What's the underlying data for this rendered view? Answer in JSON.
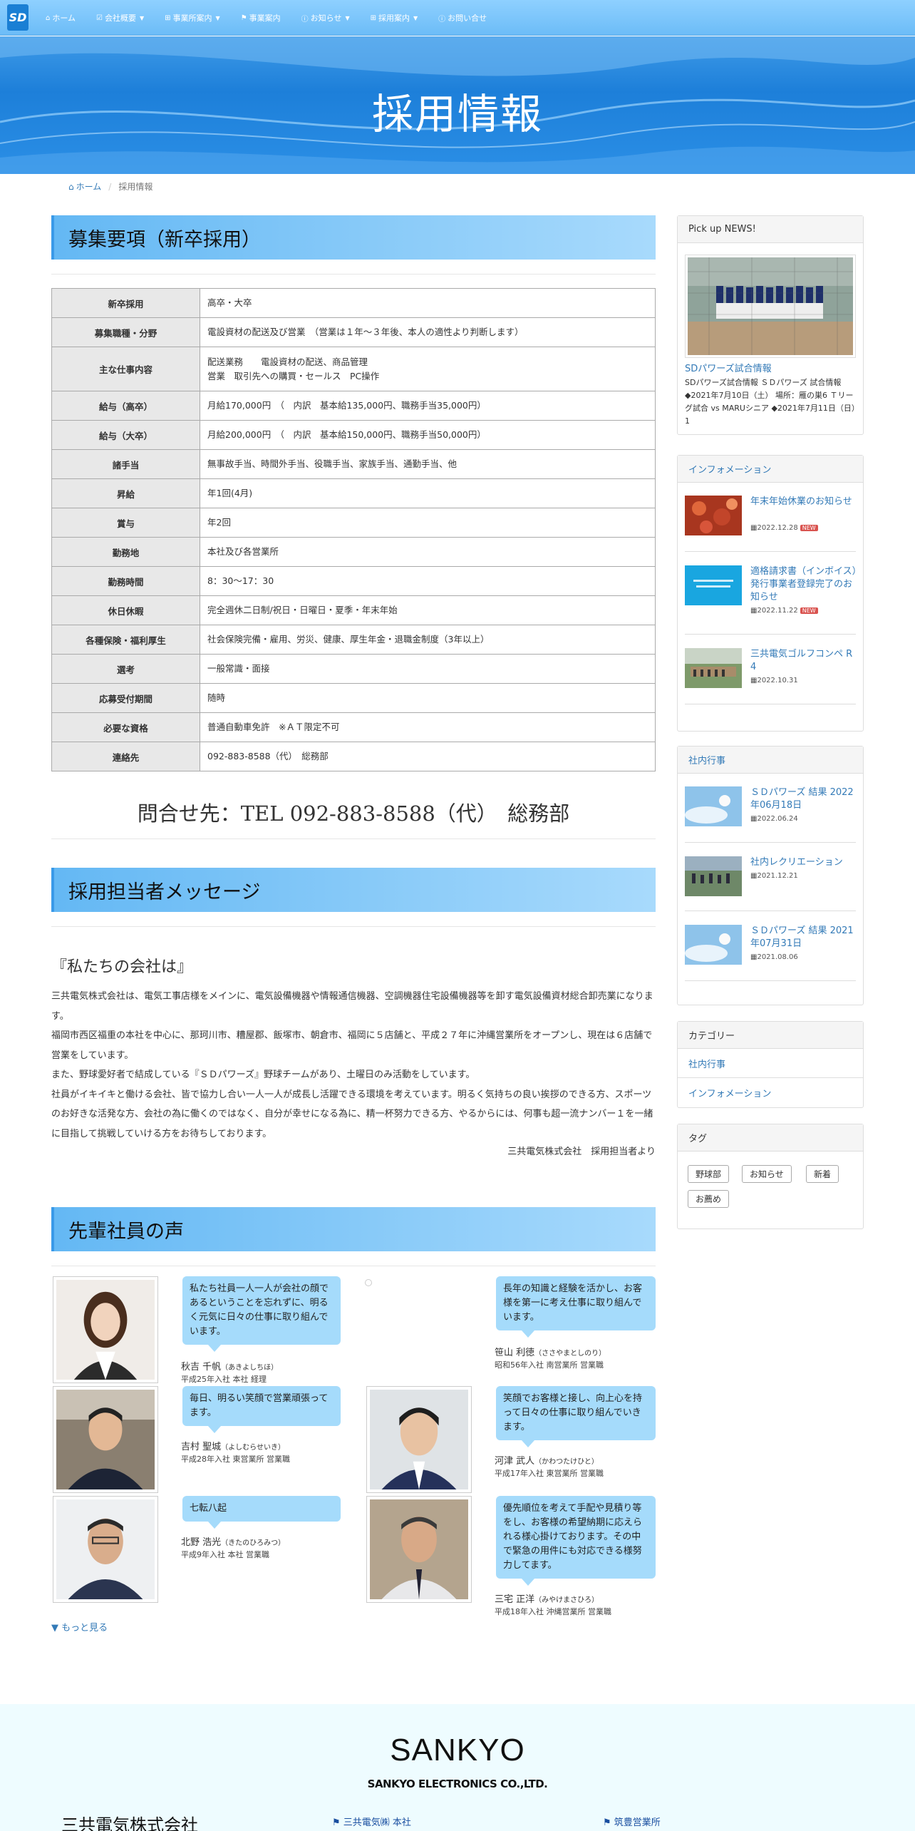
{
  "nav": {
    "logo": "SD",
    "items": [
      {
        "label": "ホーム",
        "icon": "home-icon",
        "caret": false
      },
      {
        "label": "会社概要",
        "icon": "check-icon",
        "caret": true
      },
      {
        "label": "事業所案内",
        "icon": "plus-box-icon",
        "caret": true
      },
      {
        "label": "事業案内",
        "icon": "flag-icon",
        "caret": false
      },
      {
        "label": "お知らせ",
        "icon": "info-icon",
        "caret": true
      },
      {
        "label": "採用案内",
        "icon": "plus-box-icon",
        "caret": true
      },
      {
        "label": "お問い合せ",
        "icon": "info-icon",
        "caret": false
      }
    ]
  },
  "hero": {
    "title": "採用情報"
  },
  "breadcrumb": {
    "home": "ホーム",
    "separator": "/",
    "current": "採用情報"
  },
  "requirements": {
    "heading": "募集要項（新卒採用）",
    "rows": [
      {
        "k": "新卒採用",
        "v": "高卒・大卒"
      },
      {
        "k": "募集職種・分野",
        "v": "電設資材の配送及び営業　（営業は１年～３年後、本人の適性より判断します）"
      },
      {
        "k": "主な仕事内容",
        "v": "配送業務　　電設資材の配送、商品管理\n営業　取引先への購買・セールス　PC操作"
      },
      {
        "k": "給与（高卒）",
        "v": "月給170,000円　（　内訳　基本給135,000円、職務手当35,000円）"
      },
      {
        "k": "給与（大卒）",
        "v": "月給200,000円　（　内訳　基本給150,000円、職務手当50,000円）"
      },
      {
        "k": "諸手当",
        "v": "無事故手当、時間外手当、役職手当、家族手当、通勤手当、他"
      },
      {
        "k": "昇給",
        "v": "年1回(4月)"
      },
      {
        "k": "賞与",
        "v": "年2回"
      },
      {
        "k": "勤務地",
        "v": "本社及び各営業所"
      },
      {
        "k": "勤務時間",
        "v": "8：30～17：30"
      },
      {
        "k": "休日休暇",
        "v": "完全週休二日制/祝日・日曜日・夏季・年末年始"
      },
      {
        "k": "各種保険・福利厚生",
        "v": "社会保険完備・雇用、労災、健康、厚生年金・退職金制度（3年以上）"
      },
      {
        "k": "選考",
        "v": "一般常識・面接"
      },
      {
        "k": "応募受付期間",
        "v": "随時"
      },
      {
        "k": "必要な資格",
        "v": "普通自動車免許　※ＡＴ限定不可"
      },
      {
        "k": "連絡先",
        "v": "092-883-8588（代）　総務部"
      }
    ],
    "contact": "問合せ先：TEL 092-883-8588（代）　総務部"
  },
  "message": {
    "heading": "採用担当者メッセージ",
    "title": "『私たちの会社は』",
    "body": [
      "三共電気株式会社は、電気工事店様をメインに、電気設備機器や情報通信機器、空調機器住宅設備機器等を卸す電気設備資材総合卸売業になります。",
      "福岡市西区福重の本社を中心に、那珂川市、糟屋郡、飯塚市、朝倉市、福岡に５店舗と、平成２７年に沖縄営業所をオープンし、現在は６店舗で営業をしています。",
      "また、野球愛好者で結成している『ＳＤパワーズ』野球チームがあり、土曜日のみ活動をしています。",
      "社員がイキイキと働ける会社、皆で協力し合い一人一人が成長し活躍できる環境を考えています。明るく気持ちの良い挨拶のできる方、スポーツのお好きな活発な方、会社の為に働くのではなく、自分が幸せになる為に、精一杯努力できる方、やるからには、何事も超一流ナンバー１を一緒に目指して挑戦していける方をお待ちしております。"
    ],
    "sign": "三共電気株式会社　採用担当者より"
  },
  "voices": {
    "heading": "先輩社員の声",
    "left": [
      {
        "quote": "私たち社員一人一人が会社の顔であるということを忘れずに、明るく元気に日々の仕事に取り組んでいます。",
        "name": "秋吉 千帆",
        "kana": "（あきよしちほ）",
        "info": "平成25年入社 本社 経理"
      },
      {
        "quote": "毎日、明るい笑顔で営業頑張ってます。",
        "name": "吉村 聖城",
        "kana": "（よしむらせいき）",
        "info": "平成28年入社 東営業所 営業職"
      },
      {
        "quote": "七転八起",
        "name": "北野 浩光",
        "kana": "（きたのひろみつ）",
        "info": "平成9年入社 本社 営業職"
      }
    ],
    "right": [
      {
        "quote": "長年の知識と経験を活かし、お客様を第一に考え仕事に取り組んでいます。",
        "name": "笹山 利徳",
        "kana": "（ささやまとしのり）",
        "info": "昭和56年入社 南営業所 営業職"
      },
      {
        "quote": "笑顔でお客様と接し、向上心を持って日々の仕事に取り組んでいきます。",
        "name": "河津 武人",
        "kana": "（かわつたけひと）",
        "info": "平成17年入社 東営業所 営業職"
      },
      {
        "quote": "優先順位を考えて手配や見積り等をし、お客様の希望納期に応えられる様心掛けております。その中で緊急の用件にも対応できる様努力してます。",
        "name": "三宅 正洋",
        "kana": "（みやけまさひろ）",
        "info": "平成18年入社 沖縄営業所 営業職"
      }
    ],
    "more": "▼ もっと見る"
  },
  "sidebar": {
    "pickup": {
      "header": "Pick up NEWS!",
      "title": "SDパワーズ試合情報",
      "text": "SDパワーズ試合情報 ＳＤパワーズ 試合情報 ◆2021年7月10日（土） 場所：雁の巣6 Ｔリーグ試合 vs MARUシニア ◆2021年7月11日（日）1"
    },
    "info": {
      "header": "インフォメーション",
      "items": [
        {
          "title": "年末年始休業のお知らせ",
          "date": "2022.12.28",
          "new": "NEW"
        },
        {
          "title": "適格請求書（インボイス）発行事業者登録完了のお知らせ",
          "date": "2022.11.22",
          "new": "NEW"
        },
        {
          "title": "三共電気ゴルフコンペ R 4",
          "date": "2022.10.31",
          "new": ""
        }
      ]
    },
    "events": {
      "header": "社内行事",
      "items": [
        {
          "title": "ＳＤパワーズ 結果 2022年06月18日",
          "date": "2022.06.24"
        },
        {
          "title": "社内レクリエーション",
          "date": "2021.12.21"
        },
        {
          "title": "ＳＤパワーズ 結果 2021年07月31日",
          "date": "2021.08.06"
        }
      ]
    },
    "categories": {
      "header": "カテゴリー",
      "items": [
        "社内行事",
        "インフォメーション"
      ]
    },
    "tags": {
      "header": "タグ",
      "items": [
        "野球部",
        "お知らせ",
        "新着",
        "お薦め"
      ]
    }
  },
  "footer": {
    "logo": "SANKYO",
    "sub": "SANKYO ELECTRONICS CO.,LTD.",
    "company": "三共電気株式会社",
    "links": [
      "三共電気㈱ 本社",
      "筑豊営業所"
    ]
  },
  "colors": {
    "accent": "#337ab7",
    "header_grad": "#64b8f4",
    "bubble": "#a5dbfb",
    "footer_bg": "#eefcff"
  }
}
